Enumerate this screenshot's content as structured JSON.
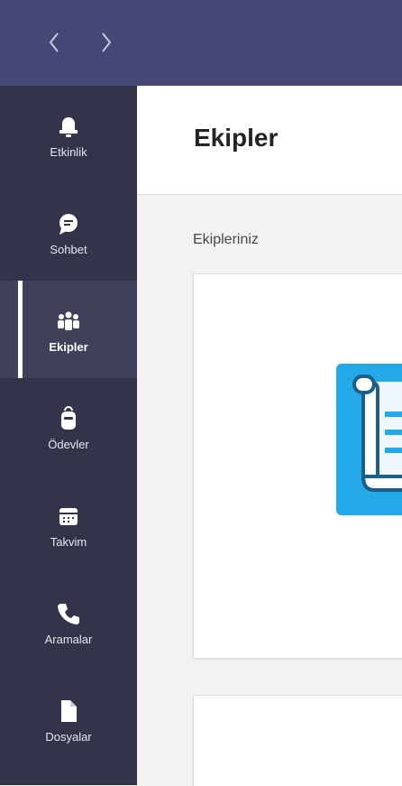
{
  "header": {
    "title": "Ekipler"
  },
  "section": {
    "title": "Ekipleriniz"
  },
  "rail": {
    "items": [
      {
        "label": "Etkinlik",
        "icon": "bell-icon"
      },
      {
        "label": "Sohbet",
        "icon": "chat-icon"
      },
      {
        "label": "Ekipler",
        "icon": "teams-icon",
        "active": true
      },
      {
        "label": "Ödevler",
        "icon": "backpack-icon"
      },
      {
        "label": "Takvim",
        "icon": "calendar-icon"
      },
      {
        "label": "Aramalar",
        "icon": "phone-icon"
      },
      {
        "label": "Dosyalar",
        "icon": "file-icon"
      }
    ]
  },
  "colors": {
    "topbar": "#464775",
    "rail": "#33344a",
    "rail_active": "#3f4059",
    "accent_blue": "#23a9e8",
    "background": "#f3f2f1"
  }
}
